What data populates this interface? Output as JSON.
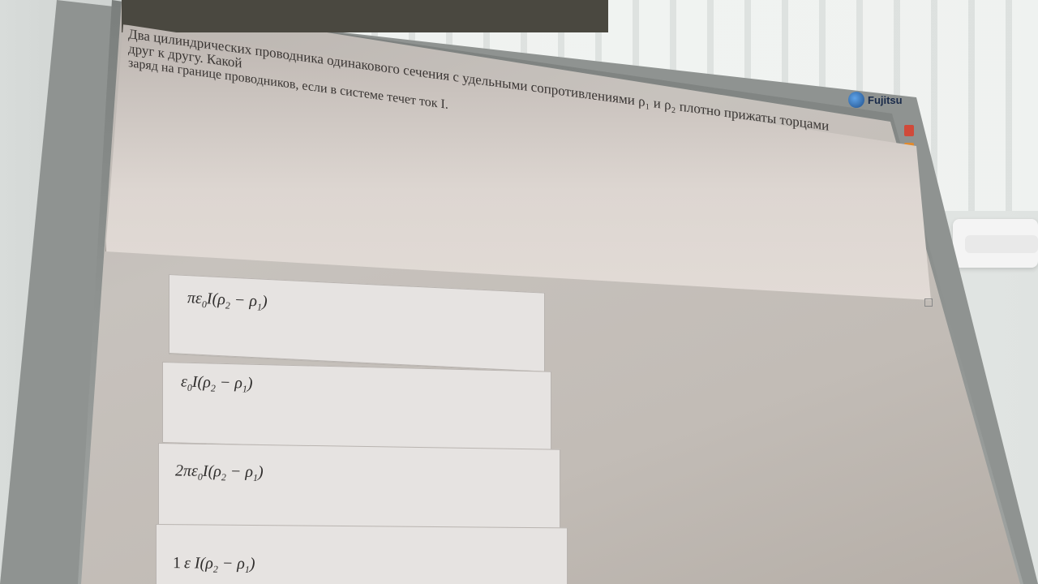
{
  "question": {
    "line1": "Два цилиндрических проводника одинакового сечения с удельными сопротивлениями ρ₁ и ρ₂ плотно прижаты торцами друг к другу. Какой",
    "line2": "заряд на границе проводников, если в системе течет ток I."
  },
  "answers": [
    {
      "prefix": "πε",
      "sub0": "0",
      "mid": "I(ρ",
      "sub2": "2",
      "minus": " − ρ",
      "sub1": "1",
      "close": ")"
    },
    {
      "prefix": "ε",
      "sub0": "0",
      "mid": "I(ρ",
      "sub2": "2",
      "minus": " − ρ",
      "sub1": "1",
      "close": ")"
    },
    {
      "prefix": "2πε",
      "sub0": "0",
      "mid": "I(ρ",
      "sub2": "2",
      "minus": " − ρ",
      "sub1": "1",
      "close": ")"
    },
    {
      "prefix": "1",
      "sub0": "",
      "mid": "ε I(ρ",
      "sub2": "2",
      "minus": " − ρ",
      "sub1": "1",
      "close": ")"
    }
  ],
  "monitor": {
    "brand": "Fujitsu"
  },
  "colors": {
    "screen": "#c7c2bd",
    "bezel": "#8f9391",
    "topbar": "#4a4840"
  }
}
